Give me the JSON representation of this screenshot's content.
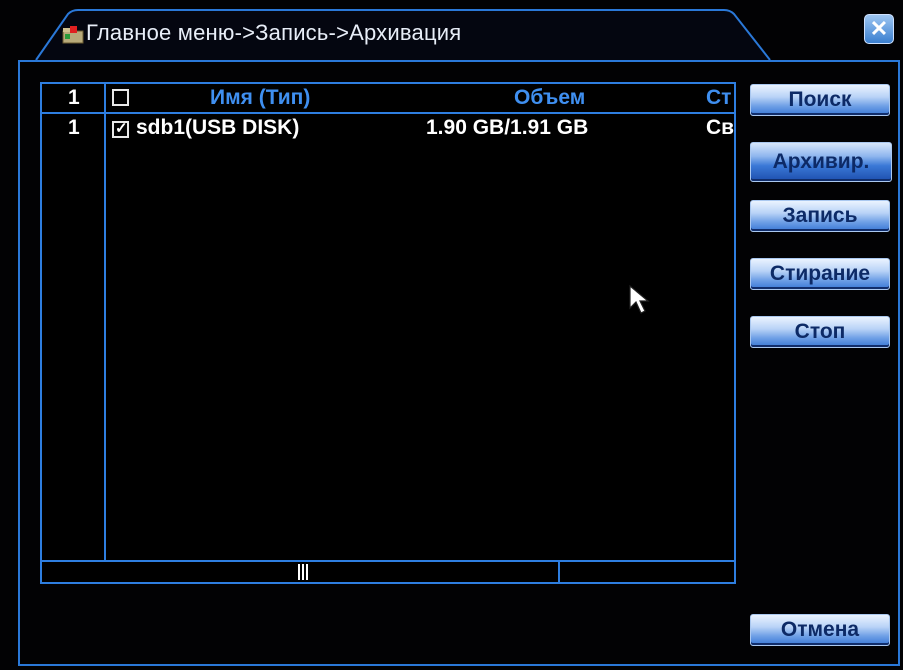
{
  "window": {
    "title": "Главное меню->Запись->Архивация",
    "close_glyph": "✕"
  },
  "table": {
    "headers": {
      "index": "1",
      "name": "Имя (Тип)",
      "size": "Объем",
      "status": "Ст"
    },
    "header_checkbox_checked": false,
    "rows": [
      {
        "index": "1",
        "checked": true,
        "name": "sdb1(USB DISK)",
        "size": "1.90 GB/1.91 GB",
        "status": "Св"
      }
    ]
  },
  "buttons": {
    "search": "Поиск",
    "archive": "Архивир.",
    "record": "Запись",
    "erase": "Стирание",
    "stop": "Стоп",
    "cancel": "Отмена"
  },
  "icons": {
    "title_icon": "folder-icon",
    "close_icon": "close-icon",
    "pointer": "mouse-cursor-icon"
  },
  "colors": {
    "accent": "#2e7ee0",
    "header_text": "#3f8ff0",
    "background": "#000000"
  }
}
